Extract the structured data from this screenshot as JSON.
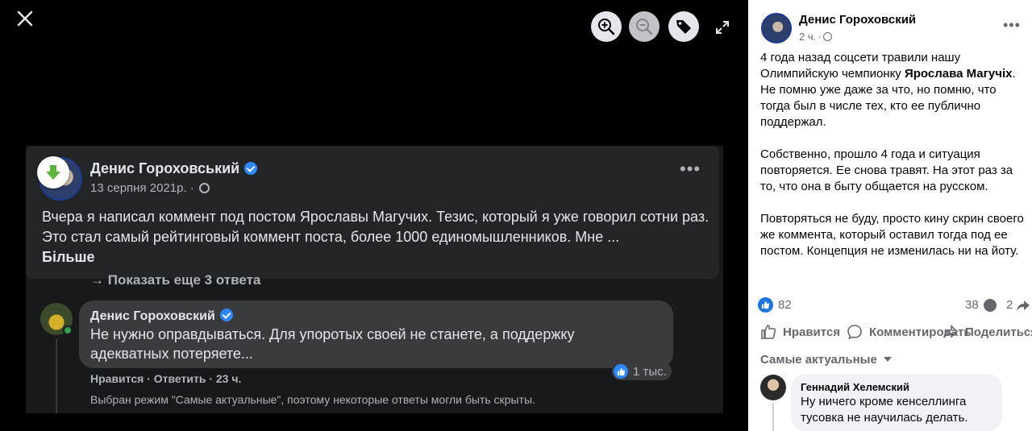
{
  "viewer": {
    "close_icon": "close-icon",
    "tools": [
      "zoom-in-icon",
      "zoom-out-icon",
      "tag-icon",
      "fullscreen-icon"
    ],
    "embedded": {
      "post": {
        "author": "Денис Гороховський",
        "date": "13 серпня 2021р.",
        "separator": "·",
        "text": "Вчера я написал коммент под постом Ярославы Магучих. Тезис, который я уже говорил сотни раз. Это стал самый рейтинговый коммент поста, более 1000 единомышленников. Мне ...",
        "more_link": "Більше",
        "more_icon": "•••"
      },
      "show_more_replies": "→ Показать еще 3 ответа",
      "comment": {
        "author": "Денис Гороховский",
        "text": "Не нужно оправдываться. Для упоротых своей не станете, а поддержку адекватных потеряете...",
        "reactions": "1 тыс.",
        "actions": "Нравится · Ответить · 23 ч.",
        "note": "Выбран режим \"Самые актуальные\", поэтому некоторые ответы могли быть скрыты."
      }
    }
  },
  "panel": {
    "author": "Денис Гороховский",
    "time": "2 ч.",
    "separator": "·",
    "more_icon": "•••",
    "text": {
      "p1_before": "4 года назад соцсети травили нашу Олимпийскую чемпионку ",
      "p1_bold": "Ярослава Магучiх",
      "p1_after": ". Не помню уже даже за что, но помню, что тогда был в числе тех, кто ее публично поддержал.",
      "p2": "Собственно, прошло 4 года и ситуация повторяется. Ее снова травят. На этот раз за то, что она в быту общается на русском.",
      "p3": "Повторяться не буду, просто кину скрин своего же коммента, который оставил тогда под ее постом. Концепция не изменилась ни на йоту."
    },
    "stats": {
      "likes": "82",
      "comments": "38",
      "shares": "2"
    },
    "actions": {
      "like": "Нравится",
      "comment": "Комментировать",
      "share": "Поделиться"
    },
    "sort_label": "Самые актуальные",
    "comment": {
      "author": "Геннадий Хелемский",
      "text": "Ну ничего кроме кенселлинга тусовка не научилась делать."
    },
    "colors": {
      "accent": "#1b74e4",
      "verified": "#2d88ff"
    }
  }
}
